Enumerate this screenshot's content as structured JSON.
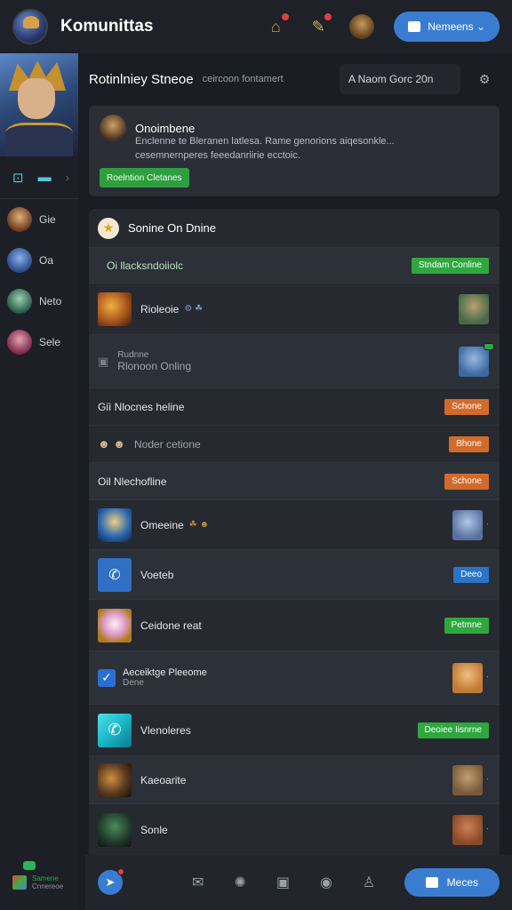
{
  "app": {
    "title": "Komunittas",
    "top_button_label": "Nemeens ⌄"
  },
  "rail": {
    "tool_symbol": "⊡",
    "tool_dash": "▬",
    "tool_arrow": "›",
    "users": [
      {
        "name": "Gie",
        "color": "#c88a52"
      },
      {
        "name": "Oa",
        "color": "#5e7fc8"
      },
      {
        "name": "Neto",
        "color": "#6aa08a"
      },
      {
        "name": "Sele",
        "color": "#c06080"
      }
    ],
    "footer_line1": "Samene",
    "footer_line2": "Cnnereoe"
  },
  "main": {
    "section_title": "Rotinlniey Stneoe",
    "section_subtitle": "ceircoon fontamert",
    "search_value": "A Naom Gorc 20n",
    "info_card": {
      "title": "Onoimbene",
      "desc_line1": "Enclenne te Bleranen latlesa. Rame genorions aiqesonkle...",
      "desc_line2": "cesemnernperes feeedanriirie ecctoic.",
      "button_label": "Roelntion Cletanes"
    },
    "list": {
      "title": "Sonine On Dnine",
      "rows": [
        {
          "label": "Oi llacksndoiiolc",
          "prefix": "",
          "tag": "Stndam Conline",
          "tag_color": "green",
          "thumb": "",
          "avatar": "",
          "style": "alt"
        },
        {
          "label": "Rioleoie",
          "prefix": "",
          "tag": "",
          "tag_color": "",
          "thumb": "#a8551e",
          "avatar": "#4a6a48",
          "style": "",
          "extra": "⚙ ☘"
        },
        {
          "label": "Rudnne",
          "sub": "Rlonoon Onling",
          "prefix": "",
          "tag": "",
          "tag_color": "",
          "thumb": "",
          "avatar": "#3c6aa0",
          "style": "alt"
        },
        {
          "label": "Giì Nlocnes heline",
          "prefix": "",
          "tag": "Schone",
          "tag_color": "orange",
          "thumb": "",
          "avatar": "",
          "style": ""
        },
        {
          "label": "Noder cetione",
          "prefix": "",
          "tag": "Bhone",
          "tag_color": "orange",
          "thumb": "",
          "avatar": "",
          "style": "",
          "extra": "☻ ☻"
        },
        {
          "label": "Oil Nlechofline",
          "prefix": "",
          "tag": "Schone",
          "tag_color": "orange",
          "thumb": "",
          "avatar": "",
          "style": "alt"
        },
        {
          "label": "Omeeine",
          "prefix": "",
          "tag": "",
          "tag_color": "",
          "thumb": "#2d6ab0",
          "avatar": "#5a70a0",
          "style": "",
          "extra": "☘ ☻"
        },
        {
          "label": "Voeteb",
          "prefix": "",
          "tag": "Deeo",
          "tag_color": "blue",
          "thumb": "#2f6fc4",
          "avatar": "",
          "style": "alt"
        },
        {
          "label": "Ceidone reat",
          "prefix": "",
          "tag": "Petmne",
          "tag_color": "green",
          "thumb": "#e0a0d0",
          "avatar": "",
          "style": ""
        },
        {
          "label": "Aeceiktge Pleeome",
          "sub": "Dene",
          "prefix": "",
          "tag": "",
          "tag_color": "",
          "thumb": "#2a6fd4",
          "avatar": "#c07a34",
          "style": "alt"
        },
        {
          "label": "Vlenoleres",
          "prefix": "",
          "tag": "Deoiee Iisnrne",
          "tag_color": "green",
          "thumb": "#19b8c8",
          "avatar": "",
          "style": ""
        },
        {
          "label": "Kaeoarite",
          "prefix": "",
          "tag": "",
          "tag_color": "",
          "thumb": "#5a3a20",
          "avatar": "#7a5a3a",
          "style": "alt"
        },
        {
          "label": "Sonle",
          "prefix": "",
          "tag": "",
          "tag_color": "",
          "thumb": "#203a2a",
          "avatar": "#8a4a2a",
          "style": ""
        }
      ]
    }
  },
  "bottom_nav": {
    "pill_label": "Meces"
  },
  "colors": {
    "accent": "#3a7dd0",
    "green": "#2ea83e",
    "orange": "#d26a2a"
  }
}
